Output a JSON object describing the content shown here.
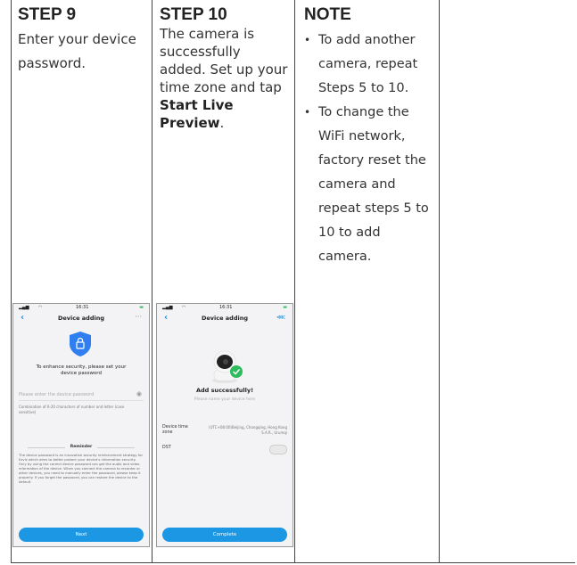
{
  "step9": {
    "title": "STEP 9",
    "text": "Enter your device password.",
    "phone": {
      "status_time": "16:31",
      "nav_title": "Device adding",
      "headline": "To enhance security, please set your device password",
      "input_placeholder": "Please enter the device password",
      "hint": "Combination of 6-20 characters of number and letter (case sensitive)",
      "reminder_title": "Reminder",
      "reminder_text": "The device password is an innovative security reinforcement strategy for Ezviz which aims to better protect your device's information security. Only by using the correct device password can get the audio and video information of the device. When you connect the camera to recorder or other devices, you need to manually enter the password, please keep it properly. If you forget the password, you can restore the device to the default",
      "button_label": "Next"
    }
  },
  "step10": {
    "title": "STEP 10",
    "text_prefix": "The camera is successfully added. Set up your time zone and tap ",
    "text_bold": "Start Live Preview",
    "text_suffix": ".",
    "phone": {
      "status_time": "16:31",
      "nav_title": "Device adding",
      "success_title": "Add successfully!",
      "name_placeholder": "Please name your device here",
      "tz_label": "Device time zone",
      "tz_value": "(UTC+08:00)Beijing, Chongqing, Hong Kong S.A.R., Urumqi",
      "dst_label": "DST",
      "button_label": "Complete"
    }
  },
  "note": {
    "title": "NOTE",
    "items": [
      "To add another camera, repeat Steps 5 to 10.",
      "To change the WiFi network, factory reset the camera and repeat steps 5 to 10 to add camera."
    ]
  },
  "colors": {
    "accent": "#1c97e4",
    "shield": "#2f7ff0",
    "success": "#2dbb5d",
    "border": "#444444"
  }
}
